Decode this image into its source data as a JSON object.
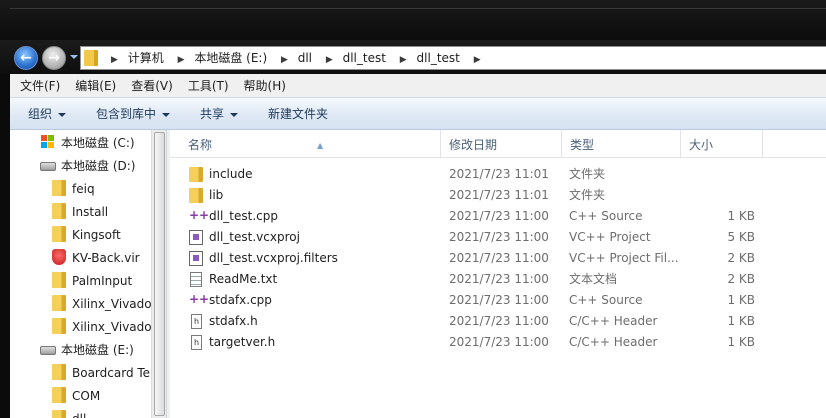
{
  "address": {
    "crumbs": [
      "计算机",
      "本地磁盘 (E:)",
      "dll",
      "dll_test",
      "dll_test"
    ]
  },
  "menu": [
    "文件(F)",
    "编辑(E)",
    "查看(V)",
    "工具(T)",
    "帮助(H)"
  ],
  "toolbar": {
    "organize": "组织",
    "include_in_library": "包含到库中",
    "share": "共享",
    "new_folder": "新建文件夹"
  },
  "nav": {
    "items": [
      {
        "label": "本地磁盘 (C:)",
        "icon": "system-drive-icon"
      },
      {
        "label": "本地磁盘 (D:)",
        "icon": "drive-icon"
      },
      {
        "label": "feiq",
        "icon": "folder-icon"
      },
      {
        "label": "Install",
        "icon": "folder-icon"
      },
      {
        "label": "Kingsoft",
        "icon": "folder-icon"
      },
      {
        "label": "KV-Back.vir",
        "icon": "antivirus-icon"
      },
      {
        "label": "PalmInput",
        "icon": "folder-icon"
      },
      {
        "label": "Xilinx_Vivado_",
        "icon": "folder-icon"
      },
      {
        "label": "Xilinx_Vivado_",
        "icon": "folder-icon"
      },
      {
        "label": "本地磁盘 (E:)",
        "icon": "drive-icon"
      },
      {
        "label": "Boardcard Te",
        "icon": "folder-icon"
      },
      {
        "label": "COM",
        "icon": "folder-icon"
      },
      {
        "label": "dll",
        "icon": "folder-icon"
      }
    ]
  },
  "columns": {
    "name": "名称",
    "date": "修改日期",
    "type": "类型",
    "size": "大小"
  },
  "files": [
    {
      "name": "include",
      "date": "2021/7/23 11:01",
      "type": "文件夹",
      "size": "",
      "icon": "folder-icon"
    },
    {
      "name": "lib",
      "date": "2021/7/23 11:01",
      "type": "文件夹",
      "size": "",
      "icon": "folder-icon"
    },
    {
      "name": "dll_test.cpp",
      "date": "2021/7/23 11:00",
      "type": "C++ Source",
      "size": "1 KB",
      "icon": "cpp-file-icon"
    },
    {
      "name": "dll_test.vcxproj",
      "date": "2021/7/23 11:00",
      "type": "VC++ Project",
      "size": "5 KB",
      "icon": "vcxproj-file-icon"
    },
    {
      "name": "dll_test.vcxproj.filters",
      "date": "2021/7/23 11:00",
      "type": "VC++ Project Fil...",
      "size": "2 KB",
      "icon": "vcxproj-filters-file-icon"
    },
    {
      "name": "ReadMe.txt",
      "date": "2021/7/23 11:00",
      "type": "文本文档",
      "size": "2 KB",
      "icon": "text-file-icon"
    },
    {
      "name": "stdafx.cpp",
      "date": "2021/7/23 11:00",
      "type": "C++ Source",
      "size": "1 KB",
      "icon": "cpp-file-icon"
    },
    {
      "name": "stdafx.h",
      "date": "2021/7/23 11:00",
      "type": "C/C++ Header",
      "size": "1 KB",
      "icon": "header-file-icon"
    },
    {
      "name": "targetver.h",
      "date": "2021/7/23 11:00",
      "type": "C/C++ Header",
      "size": "1 KB",
      "icon": "header-file-icon"
    }
  ]
}
